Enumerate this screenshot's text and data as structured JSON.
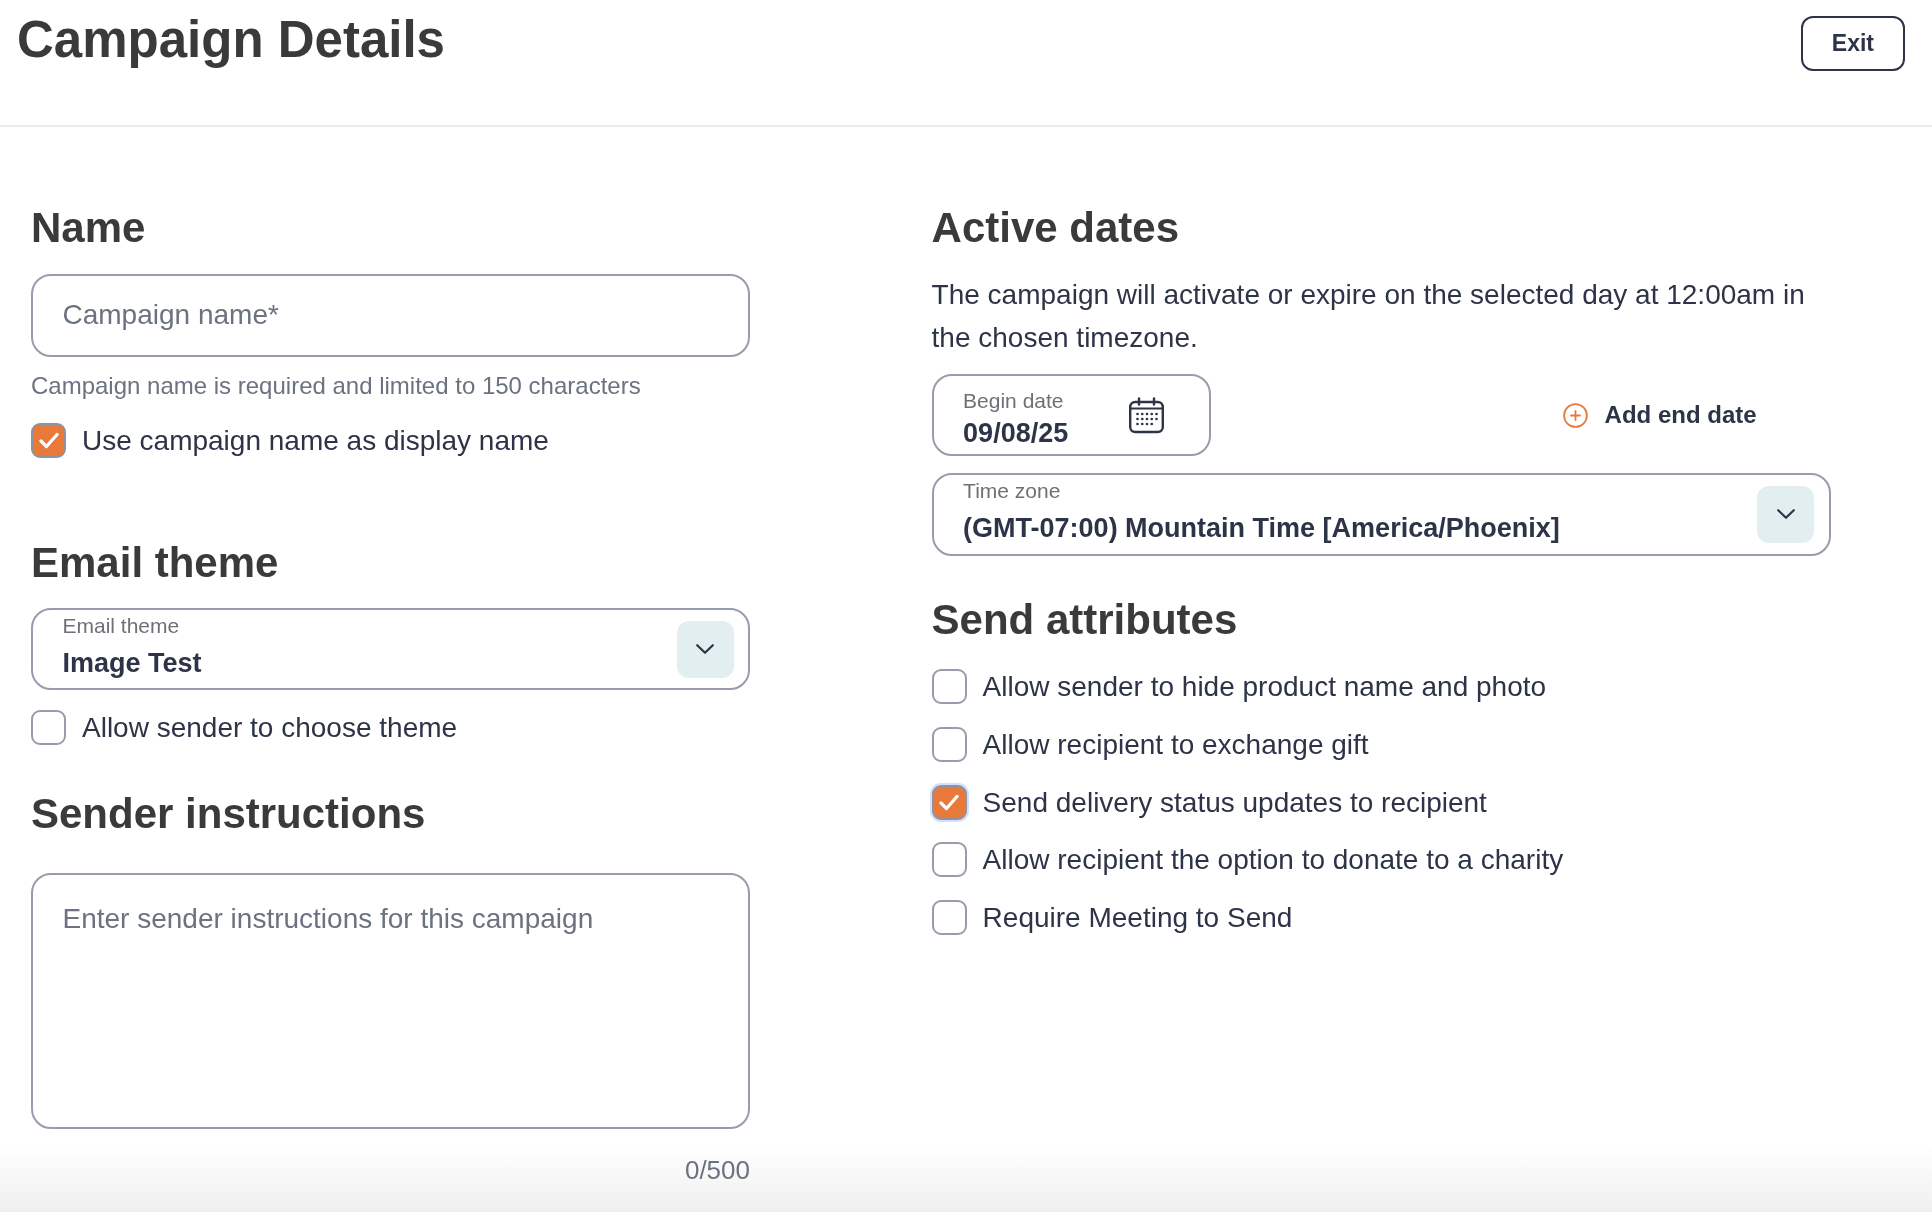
{
  "header": {
    "title": "Campaign Details",
    "exit_button": "Exit"
  },
  "name_section": {
    "heading": "Name",
    "name_field": {
      "placeholder": "Campaign name*"
    },
    "helper_text": "Campaign name is required and limited to 150 characters",
    "display_name_option": {
      "label": "Use campaign name as display name",
      "checked": true
    }
  },
  "email_theme_section": {
    "heading": "Email theme",
    "theme_select": {
      "label": "Email theme",
      "value": "Image Test"
    },
    "choose_theme_option": {
      "label": "Allow sender to choose theme",
      "checked": false
    }
  },
  "sender_instructions_section": {
    "heading": "Sender instructions",
    "instructions_field": {
      "placeholder": "Enter sender instructions for this campaign"
    },
    "character_count": "0/500"
  },
  "active_dates_section": {
    "heading": "Active dates",
    "description": "The campaign will activate or expire on the selected day at 12:00am in the chosen timezone.",
    "begin_date_field": {
      "label": "Begin date",
      "value": "09/08/25"
    },
    "add_end_date_button": "Add end date",
    "time_zone_select": {
      "label": "Time zone",
      "value": "(GMT-07:00) Mountain Time [America/Phoenix]"
    }
  },
  "send_attributes_section": {
    "heading": "Send attributes",
    "options": [
      {
        "label": "Allow sender to hide product name and photo",
        "checked": false,
        "focused": false
      },
      {
        "label": "Allow recipient to exchange gift",
        "checked": false,
        "focused": false
      },
      {
        "label": "Send delivery status updates to recipient",
        "checked": true,
        "focused": true
      },
      {
        "label": "Allow recipient the option to donate to a charity",
        "checked": false,
        "focused": false
      },
      {
        "label": "Require Meeting to Send",
        "checked": false,
        "focused": false
      }
    ]
  }
}
